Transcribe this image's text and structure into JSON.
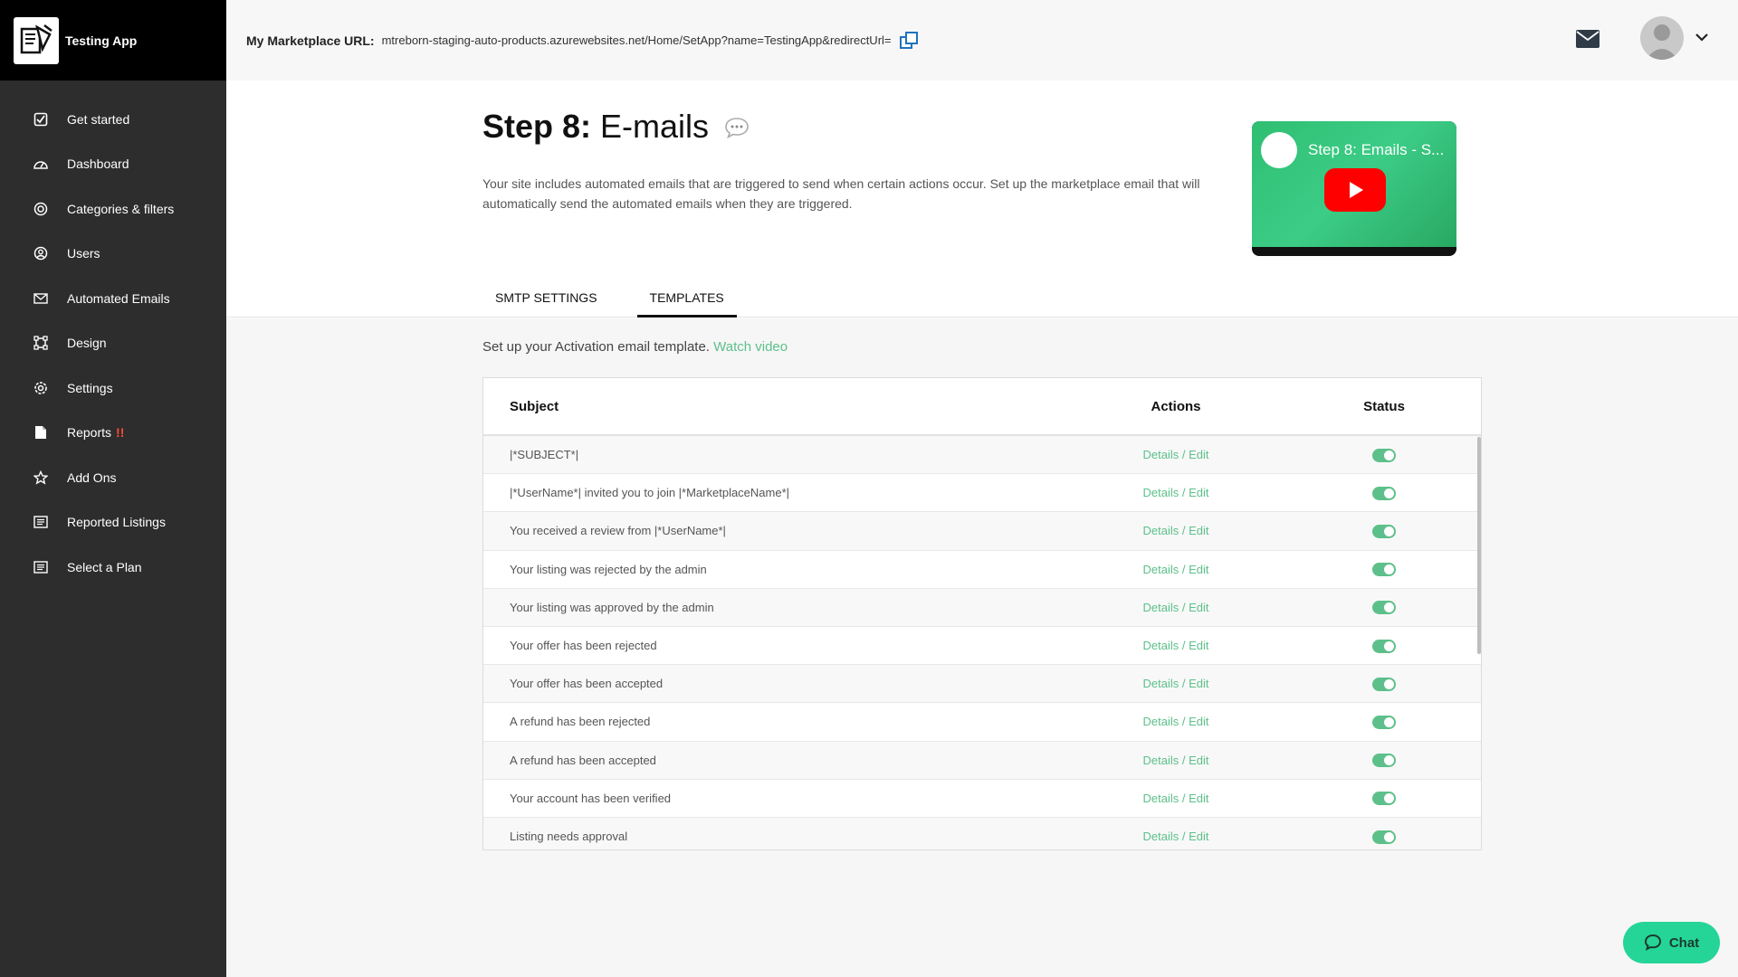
{
  "app": {
    "name": "Testing App"
  },
  "sidebar": {
    "items": [
      {
        "label": "Get started",
        "icon": "checkbox-icon"
      },
      {
        "label": "Dashboard",
        "icon": "dashboard-gauge-icon"
      },
      {
        "label": "Categories & filters",
        "icon": "target-icon"
      },
      {
        "label": "Users",
        "icon": "user-circle-icon"
      },
      {
        "label": "Automated Emails",
        "icon": "envelope-icon"
      },
      {
        "label": "Design",
        "icon": "design-frame-icon"
      },
      {
        "label": "Settings",
        "icon": "gear-icon"
      },
      {
        "label": "Reports",
        "icon": "document-icon",
        "alert": "!!"
      },
      {
        "label": "Add Ons",
        "icon": "star-icon"
      },
      {
        "label": "Reported Listings",
        "icon": "list-doc-icon"
      },
      {
        "label": "Select a Plan",
        "icon": "list-doc-icon"
      }
    ]
  },
  "topbar": {
    "url_label": "My Marketplace URL:",
    "url_value": "mtreborn-staging-auto-products.azurewebsites.net/Home/SetApp?name=TestingApp&redirectUrl="
  },
  "page": {
    "step_label": "Step 8:",
    "step_name": "E-mails",
    "description": "Your site includes automated emails that are triggered to send when certain actions occur. Set up the marketplace email that will automatically send the automated emails when they are triggered.",
    "video_title": "Step 8: Emails - S..."
  },
  "tabs": [
    {
      "label": "SMTP SETTINGS",
      "active": false
    },
    {
      "label": "TEMPLATES",
      "active": true
    }
  ],
  "templates": {
    "intro": "Set up your Activation email template.",
    "intro_link": "Watch video",
    "headers": {
      "subject": "Subject",
      "actions": "Actions",
      "status": "Status"
    },
    "action_label": "Details / Edit",
    "rows": [
      {
        "subject": "|*SUBJECT*|",
        "enabled": true
      },
      {
        "subject": "|*UserName*| invited you to join |*MarketplaceName*|",
        "enabled": true
      },
      {
        "subject": "You received a review from |*UserName*|",
        "enabled": true
      },
      {
        "subject": "Your listing was rejected by the admin",
        "enabled": true
      },
      {
        "subject": "Your listing was approved by the admin",
        "enabled": true
      },
      {
        "subject": "Your offer has been rejected",
        "enabled": true
      },
      {
        "subject": "Your offer has been accepted",
        "enabled": true
      },
      {
        "subject": "A refund has been rejected",
        "enabled": true
      },
      {
        "subject": "A refund has been accepted",
        "enabled": true
      },
      {
        "subject": "Your account has been verified",
        "enabled": true
      },
      {
        "subject": "Listing needs approval",
        "enabled": true
      }
    ]
  },
  "chat": {
    "label": "Chat"
  },
  "colors": {
    "accent": "#5dc08a",
    "sidebar": "#2d2d2d",
    "chat": "#25d597"
  }
}
